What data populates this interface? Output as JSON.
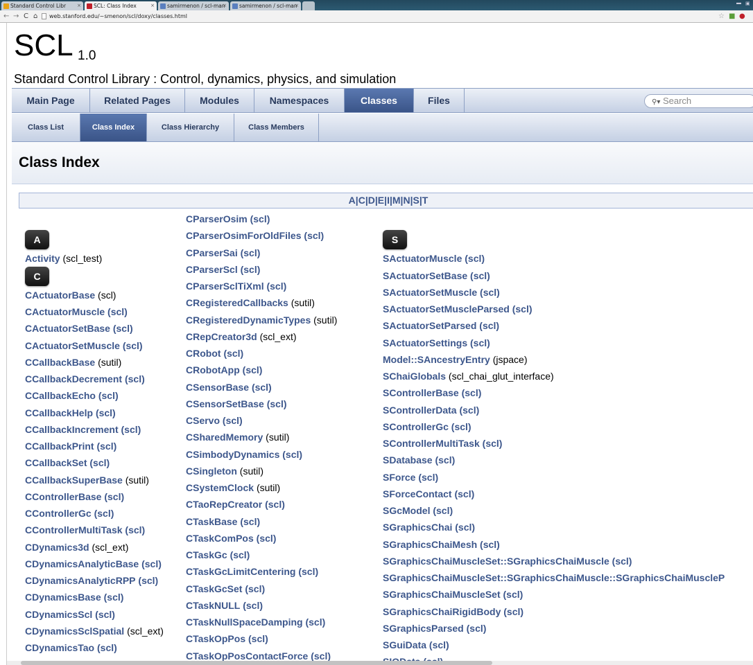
{
  "browser": {
    "tabs": [
      {
        "title": "Standard Control Libr",
        "favicon_color": "#e8a316",
        "active": false
      },
      {
        "title": "SCL: Class Index",
        "favicon_color": "#c0202a",
        "active": true
      },
      {
        "title": "samirmenon / scl-man",
        "favicon_color": "#5a7fbf",
        "active": false
      },
      {
        "title": "samirmenon / scl-man",
        "favicon_color": "#5a7fbf",
        "active": false
      }
    ],
    "url": "web.stanford.edu/~smenon/scl/doxy/classes.html"
  },
  "project": {
    "name": "SCL",
    "number": "1.0",
    "brief": "Standard Control Library : Control, dynamics, physics, and simulation"
  },
  "main_tabs": [
    "Main Page",
    "Related Pages",
    "Modules",
    "Namespaces",
    "Classes",
    "Files"
  ],
  "search": {
    "placeholder": "Search"
  },
  "sub_tabs": [
    "Class List",
    "Class Index",
    "Class Hierarchy",
    "Class Members"
  ],
  "title": "Class Index",
  "letters": [
    "A",
    "C",
    "D",
    "E",
    "I",
    "M",
    "N",
    "S",
    "T"
  ],
  "columns": [
    [
      {
        "type": "letter",
        "text": "A"
      },
      {
        "cls": "Activity",
        "ns": "(scl_test)",
        "ns_link": false
      },
      {
        "type": "letter",
        "text": "C"
      },
      {
        "cls": "CActuatorBase",
        "ns": "(scl)",
        "ns_link": false
      },
      {
        "cls": "CActuatorMuscle",
        "ns": "(scl)",
        "ns_link": true
      },
      {
        "cls": "CActuatorSetBase",
        "ns": "(scl)",
        "ns_link": true
      },
      {
        "cls": "CActuatorSetMuscle",
        "ns": "(scl)",
        "ns_link": true
      },
      {
        "cls": "CCallbackBase",
        "ns": "(sutil)",
        "ns_link": false
      },
      {
        "cls": "CCallbackDecrement",
        "ns": "(scl)",
        "ns_link": true
      },
      {
        "cls": "CCallbackEcho",
        "ns": "(scl)",
        "ns_link": true
      },
      {
        "cls": "CCallbackHelp",
        "ns": "(scl)",
        "ns_link": true
      },
      {
        "cls": "CCallbackIncrement",
        "ns": "(scl)",
        "ns_link": true
      },
      {
        "cls": "CCallbackPrint",
        "ns": "(scl)",
        "ns_link": true
      },
      {
        "cls": "CCallbackSet",
        "ns": "(scl)",
        "ns_link": true
      },
      {
        "cls": "CCallbackSuperBase",
        "ns": "(sutil)",
        "ns_link": false
      },
      {
        "cls": "CControllerBase",
        "ns": "(scl)",
        "ns_link": true
      },
      {
        "cls": "CControllerGc",
        "ns": "(scl)",
        "ns_link": true
      },
      {
        "cls": "CControllerMultiTask",
        "ns": "(scl)",
        "ns_link": true
      },
      {
        "cls": "CDynamics3d",
        "ns": "(scl_ext)",
        "ns_link": false
      },
      {
        "cls": "CDynamicsAnalyticBase",
        "ns": "(scl)",
        "ns_link": true
      },
      {
        "cls": "CDynamicsAnalyticRPP",
        "ns": "(scl)",
        "ns_link": true
      },
      {
        "cls": "CDynamicsBase",
        "ns": "(scl)",
        "ns_link": true
      },
      {
        "cls": "CDynamicsScl",
        "ns": "(scl)",
        "ns_link": true
      },
      {
        "cls": "CDynamicsSclSpatial",
        "ns": "(scl_ext)",
        "ns_link": false
      },
      {
        "cls": "CDynamicsTao",
        "ns": "(scl)",
        "ns_link": true
      }
    ],
    [
      {
        "cls": "CParserOsim",
        "ns": "(scl)",
        "ns_link": true
      },
      {
        "cls": "CParserOsimForOldFiles",
        "ns": "(scl)",
        "ns_link": true
      },
      {
        "cls": "CParserSai",
        "ns": "(scl)",
        "ns_link": true
      },
      {
        "cls": "CParserScl",
        "ns": "(scl)",
        "ns_link": true
      },
      {
        "cls": "CParserSclTiXml",
        "ns": "(scl)",
        "ns_link": true
      },
      {
        "cls": "CRegisteredCallbacks",
        "ns": "(sutil)",
        "ns_link": false
      },
      {
        "cls": "CRegisteredDynamicTypes",
        "ns": "(sutil)",
        "ns_link": false
      },
      {
        "cls": "CRepCreator3d",
        "ns": "(scl_ext)",
        "ns_link": false
      },
      {
        "cls": "CRobot",
        "ns": "(scl)",
        "ns_link": true
      },
      {
        "cls": "CRobotApp",
        "ns": "(scl)",
        "ns_link": true
      },
      {
        "cls": "CSensorBase",
        "ns": "(scl)",
        "ns_link": true
      },
      {
        "cls": "CSensorSetBase",
        "ns": "(scl)",
        "ns_link": true
      },
      {
        "cls": "CServo",
        "ns": "(scl)",
        "ns_link": true
      },
      {
        "cls": "CSharedMemory",
        "ns": "(sutil)",
        "ns_link": false
      },
      {
        "cls": "CSimbodyDynamics",
        "ns": "(scl)",
        "ns_link": true
      },
      {
        "cls": "CSingleton",
        "ns": "(sutil)",
        "ns_link": false
      },
      {
        "cls": "CSystemClock",
        "ns": "(sutil)",
        "ns_link": false
      },
      {
        "cls": "CTaoRepCreator",
        "ns": "(scl)",
        "ns_link": true
      },
      {
        "cls": "CTaskBase",
        "ns": "(scl)",
        "ns_link": true
      },
      {
        "cls": "CTaskComPos",
        "ns": "(scl)",
        "ns_link": true
      },
      {
        "cls": "CTaskGc",
        "ns": "(scl)",
        "ns_link": true
      },
      {
        "cls": "CTaskGcLimitCentering",
        "ns": "(scl)",
        "ns_link": true
      },
      {
        "cls": "CTaskGcSet",
        "ns": "(scl)",
        "ns_link": true
      },
      {
        "cls": "CTaskNULL",
        "ns": "(scl)",
        "ns_link": true
      },
      {
        "cls": "CTaskNullSpaceDamping",
        "ns": "(scl)",
        "ns_link": true
      },
      {
        "cls": "CTaskOpPos",
        "ns": "(scl)",
        "ns_link": true
      },
      {
        "cls": "CTaskOpPosContactForce",
        "ns": "(scl)",
        "ns_link": true
      }
    ],
    [
      {
        "type": "letter",
        "text": "S"
      },
      {
        "cls": "SActuatorMuscle",
        "ns": "(scl)",
        "ns_link": true
      },
      {
        "cls": "SActuatorSetBase",
        "ns": "(scl)",
        "ns_link": true
      },
      {
        "cls": "SActuatorSetMuscle",
        "ns": "(scl)",
        "ns_link": true
      },
      {
        "cls": "SActuatorSetMuscleParsed",
        "ns": "(scl)",
        "ns_link": true
      },
      {
        "cls": "SActuatorSetParsed",
        "ns": "(scl)",
        "ns_link": true
      },
      {
        "cls": "SActuatorSettings",
        "ns": "(scl)",
        "ns_link": true
      },
      {
        "cls": "Model::SAncestryEntry",
        "ns": "(jspace)",
        "ns_link": false
      },
      {
        "cls": "SChaiGlobals",
        "ns": "(scl_chai_glut_interface)",
        "ns_link": false
      },
      {
        "cls": "SControllerBase",
        "ns": "(scl)",
        "ns_link": true
      },
      {
        "cls": "SControllerData",
        "ns": "(scl)",
        "ns_link": true
      },
      {
        "cls": "SControllerGc",
        "ns": "(scl)",
        "ns_link": true
      },
      {
        "cls": "SControllerMultiTask",
        "ns": "(scl)",
        "ns_link": true
      },
      {
        "cls": "SDatabase",
        "ns": "(scl)",
        "ns_link": true
      },
      {
        "cls": "SForce",
        "ns": "(scl)",
        "ns_link": true
      },
      {
        "cls": "SForceContact",
        "ns": "(scl)",
        "ns_link": true
      },
      {
        "cls": "SGcModel",
        "ns": "(scl)",
        "ns_link": true
      },
      {
        "cls": "SGraphicsChai",
        "ns": "(scl)",
        "ns_link": true
      },
      {
        "cls": "SGraphicsChaiMesh",
        "ns": "(scl)",
        "ns_link": true
      },
      {
        "cls": "SGraphicsChaiMuscleSet::SGraphicsChaiMuscle",
        "ns": "(scl)",
        "ns_link": true
      },
      {
        "cls": "SGraphicsChaiMuscleSet::SGraphicsChaiMuscle::SGraphicsChaiMuscleP",
        "ns": "",
        "ns_link": false
      },
      {
        "cls": "SGraphicsChaiMuscleSet",
        "ns": "(scl)",
        "ns_link": true
      },
      {
        "cls": "SGraphicsChaiRigidBody",
        "ns": "(scl)",
        "ns_link": true
      },
      {
        "cls": "SGraphicsParsed",
        "ns": "(scl)",
        "ns_link": true
      },
      {
        "cls": "SGuiData",
        "ns": "(scl)",
        "ns_link": true
      },
      {
        "cls": "SIOData",
        "ns": "(scl)",
        "ns_link": true
      }
    ]
  ]
}
